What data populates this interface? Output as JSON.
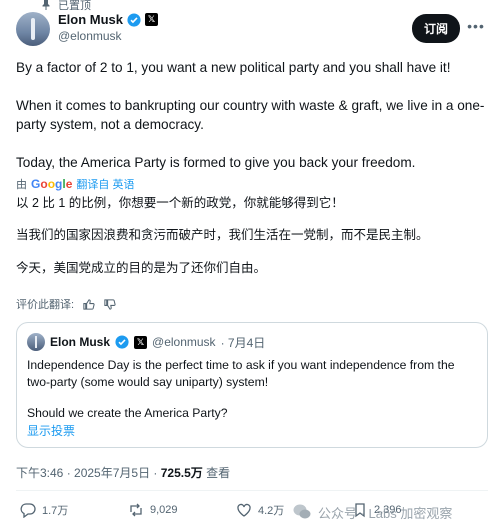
{
  "pinned_label": "已置顶",
  "author": {
    "name": "Elon Musk",
    "handle": "@elonmusk",
    "x_badge": "𝕏"
  },
  "subscribe_label": "订阅",
  "more_label": "•••",
  "tweet": {
    "paragraphs": [
      "By a factor of 2 to 1, you want a new political party and you shall have it!",
      "When it comes to bankrupting our country with waste & graft, we live in a one-party system, not a democracy.",
      "Today, the America Party is formed to give you back your freedom."
    ]
  },
  "translation": {
    "by_label": "由",
    "google": [
      "G",
      "o",
      "o",
      "g",
      "l",
      "e"
    ],
    "translated_from": "翻译自 英语",
    "paragraphs": [
      "以 2 比 1 的比例，你想要一个新的政党，你就能够得到它！",
      "当我们的国家因浪费和贪污而破产时，我们生活在一党制，而不是民主制。",
      "今天，美国党成立的目的是为了还你们自由。"
    ],
    "rate_label": "评价此翻译:"
  },
  "quote": {
    "name": "Elon Musk",
    "handle": "@elonmusk",
    "x_badge": "𝕏",
    "date": "· 7月4日",
    "paragraphs": [
      "Independence Day is the perfect time to ask if you want independence from the two-party (some would say uniparty) system!",
      "Should we create the America Party?"
    ],
    "poll_link": "显示投票"
  },
  "meta": {
    "time": "下午3:46 · 2025年7月5日 · ",
    "views": "725.5万",
    "views_suffix": " 查看"
  },
  "actions": {
    "replies": "1.7万",
    "reposts": "9,029",
    "likes": "4.2万",
    "bookmarks": "2,396"
  },
  "watermark": "公众号 · Labs 加密观察",
  "colors": {
    "accent": "#1d9bf0",
    "text": "#0f1419",
    "secondary": "#536471",
    "border": "#cfd9de"
  }
}
